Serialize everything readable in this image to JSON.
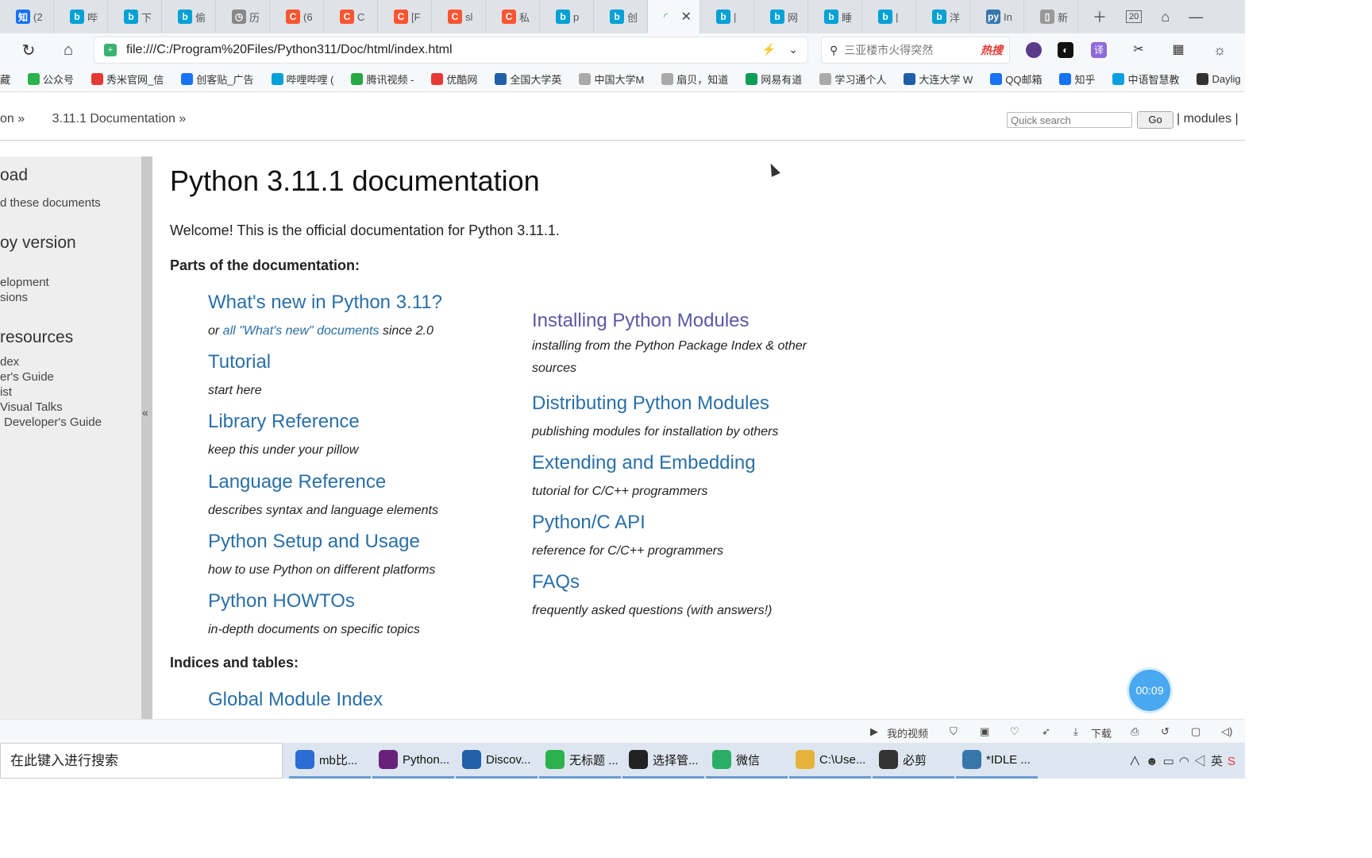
{
  "tabs": [
    {
      "icon_text": "知",
      "label": "(2",
      "color": "#1772f6"
    },
    {
      "icon_text": "b",
      "label": "哔",
      "color": "#00a1d6"
    },
    {
      "icon_text": "b",
      "label": "下",
      "color": "#00a1d6"
    },
    {
      "icon_text": "b",
      "label": "偷",
      "color": "#00a1d6"
    },
    {
      "icon_text": "◷",
      "label": "历",
      "color": "#888888"
    },
    {
      "icon_text": "C",
      "label": "(6",
      "color": "#fc5531"
    },
    {
      "icon_text": "C",
      "label": "C",
      "color": "#fc5531"
    },
    {
      "icon_text": "C",
      "label": "[F",
      "color": "#fc5531"
    },
    {
      "icon_text": "C",
      "label": "sl",
      "color": "#fc5531"
    },
    {
      "icon_text": "C",
      "label": "私",
      "color": "#fc5531"
    },
    {
      "icon_text": "b",
      "label": "p",
      "color": "#00a1d6"
    },
    {
      "icon_text": "b",
      "label": "创",
      "color": "#00a1d6"
    }
  ],
  "tabs_after": [
    {
      "icon_text": "b",
      "label": "|",
      "color": "#00a1d6"
    },
    {
      "icon_text": "b",
      "label": "网",
      "color": "#00a1d6"
    },
    {
      "icon_text": "b",
      "label": "睡",
      "color": "#00a1d6"
    },
    {
      "icon_text": "b",
      "label": "|",
      "color": "#00a1d6"
    },
    {
      "icon_text": "b",
      "label": "洋",
      "color": "#00a1d6"
    },
    {
      "icon_text": "py",
      "label": "In",
      "color": "#3776ab"
    },
    {
      "icon_text": "▯",
      "label": "新",
      "color": "#999999"
    }
  ],
  "tab_count": "20",
  "address": {
    "url": "file:///C:/Program%20Files/Python311/Doc/html/index.html",
    "search_hint": "三亚楼市火得突然",
    "hot_label": "热搜"
  },
  "bookmarks": [
    "藏",
    "公众号",
    "秀米官网_信",
    "创客贴_广告",
    "哔哩哔哩 (",
    "腾讯视频 -",
    "优酷网",
    "全国大学英",
    "中国大学M",
    "扇贝，知道",
    "网易有道",
    "学习通个人",
    "大连大学 W",
    "QQ邮箱",
    "知乎",
    "中语智慧教",
    "Daylig"
  ],
  "related": {
    "crumb_1": "on »",
    "crumb_2": "3.11.1 Documentation »",
    "quick_search_placeholder": "Quick search",
    "go_label": "Go",
    "modules_label": "| modules |"
  },
  "sidebar": {
    "heading_1": "oad",
    "item_1": "d these documents",
    "heading_2": "oy version",
    "item_2": "elopment",
    "item_3": "sions",
    "heading_3": "resources",
    "item_4": "dex",
    "item_5": "er's Guide",
    "item_6": "ist",
    "item_7": "Visual Talks",
    "item_8": "Developer's Guide",
    "collapse_label": "«"
  },
  "main": {
    "title": "Python 3.11.1 documentation",
    "welcome": "Welcome! This is the official documentation for Python 3.11.1.",
    "parts_heading": "Parts of the documentation:",
    "indices_heading": "Indices and tables:",
    "whatsnew": {
      "title": "What's new in Python 3.11?",
      "pre": "or ",
      "link": "all \"What's new\" documents",
      "post": " since 2.0"
    },
    "tutorial": {
      "title": "Tutorial",
      "desc": "start here"
    },
    "library": {
      "title": "Library Reference",
      "desc": "keep this under your pillow"
    },
    "language": {
      "title": "Language Reference",
      "desc": "describes syntax and language elements"
    },
    "setup": {
      "title": "Python Setup and Usage",
      "desc": "how to use Python on different platforms"
    },
    "howtos": {
      "title": "Python HOWTOs",
      "desc": "in-depth documents on specific topics"
    },
    "installing": {
      "title": "Installing Python Modules",
      "desc": "installing from the Python Package Index & other sources"
    },
    "distributing": {
      "title": "Distributing Python Modules",
      "desc": "publishing modules for installation by others"
    },
    "extending": {
      "title": "Extending and Embedding",
      "desc": "tutorial for C/C++ programmers"
    },
    "capi": {
      "title": "Python/C API",
      "desc": "reference for C/C++ programmers"
    },
    "faqs": {
      "title": "FAQs",
      "desc": "frequently asked questions (with answers!)"
    },
    "modindex": {
      "title": "Global Module Index"
    }
  },
  "timer": "00:09",
  "statusbar": {
    "my_video": "我的视频",
    "download": "下载"
  },
  "taskbar": {
    "search_placeholder": "在此键入进行搜索",
    "apps": [
      {
        "label": "mb比...",
        "color": "#2d6bd6"
      },
      {
        "label": "Python...",
        "color": "#68217a"
      },
      {
        "label": "Discov...",
        "color": "#1f5fa8"
      },
      {
        "label": "无标题 ...",
        "color": "#2bb24c"
      },
      {
        "label": "选择管...",
        "color": "#222222"
      },
      {
        "label": "微信",
        "color": "#2aae67"
      },
      {
        "label": "C:\\Use...",
        "color": "#e6b33a"
      },
      {
        "label": "必剪",
        "color": "#333333"
      },
      {
        "label": "*IDLE ...",
        "color": "#3776ab"
      }
    ],
    "tray_text": "英"
  }
}
